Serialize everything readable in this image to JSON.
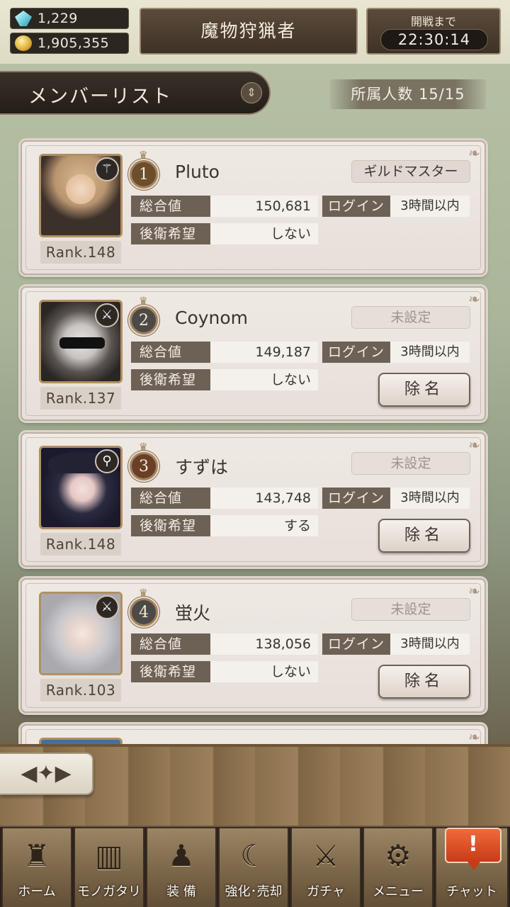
{
  "status": {
    "gems": "1,229",
    "gold": "1,905,355",
    "gem_icon": "crystal-icon",
    "gold_icon": "coin-icon"
  },
  "guild": {
    "name": "魔物狩猟者"
  },
  "war": {
    "label": "開戦まで",
    "countdown": "22:30:14"
  },
  "header": {
    "title": "メンバーリスト",
    "member_count": "所属人数 15/15"
  },
  "labels": {
    "total": "総合値",
    "backline": "後衛希望",
    "login": "ログイン",
    "remove": "除名"
  },
  "members": [
    {
      "position": "1",
      "name": "Pluto",
      "role": "ギルドマスター",
      "rank": "Rank.148",
      "total": "150,681",
      "backline": "しない",
      "login": "3時間以内",
      "weapon_icon": "staff-icon"
    },
    {
      "position": "2",
      "name": "Coynom",
      "role": "未設定",
      "rank": "Rank.137",
      "total": "149,187",
      "backline": "しない",
      "login": "3時間以内",
      "weapon_icon": "sword-icon"
    },
    {
      "position": "3",
      "name": "すずは",
      "role": "未設定",
      "rank": "Rank.148",
      "total": "143,748",
      "backline": "する",
      "login": "3時間以内",
      "weapon_icon": "wand-icon"
    },
    {
      "position": "4",
      "name": "蛍火",
      "role": "未設定",
      "rank": "Rank.103",
      "total": "138,056",
      "backline": "しない",
      "login": "3時間以内",
      "weapon_icon": "sword-icon"
    }
  ],
  "colors": {
    "badge_gold": "#6b4f2c",
    "badge_silver": "#4c4a48",
    "badge_bronze": "#6a3f28"
  },
  "nav": [
    {
      "label": "ホーム",
      "icon": "castle-icon"
    },
    {
      "label": "モノガタリ",
      "icon": "book-icon"
    },
    {
      "label": "装 備",
      "icon": "puppet-icon"
    },
    {
      "label": "強化･売却",
      "icon": "mask-icon"
    },
    {
      "label": "ガチャ",
      "icon": "crossed-swords-icon"
    },
    {
      "label": "メニュー",
      "icon": "gears-icon"
    },
    {
      "label": "チャット",
      "icon": "chat-icon"
    }
  ],
  "chat_alert": "!"
}
